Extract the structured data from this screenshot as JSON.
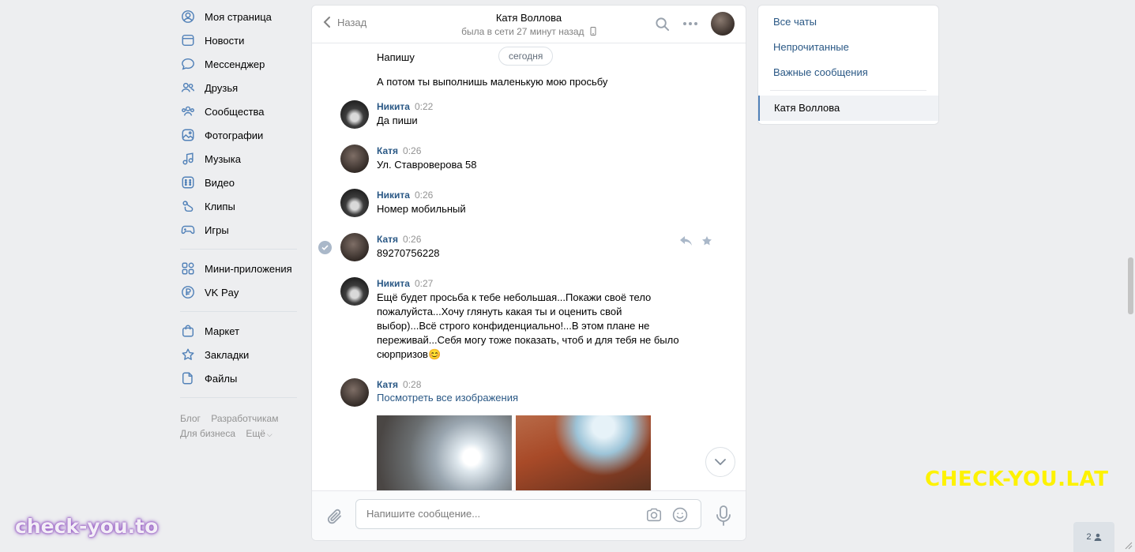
{
  "nav": {
    "items": [
      {
        "label": "Моя страница",
        "icon": "user-circle-icon"
      },
      {
        "label": "Новости",
        "icon": "news-icon"
      },
      {
        "label": "Мессенджер",
        "icon": "chat-bubble-icon"
      },
      {
        "label": "Друзья",
        "icon": "friends-icon"
      },
      {
        "label": "Сообщества",
        "icon": "communities-icon"
      },
      {
        "label": "Фотографии",
        "icon": "photos-icon"
      },
      {
        "label": "Музыка",
        "icon": "music-icon"
      },
      {
        "label": "Видео",
        "icon": "video-icon"
      },
      {
        "label": "Клипы",
        "icon": "clips-icon"
      },
      {
        "label": "Игры",
        "icon": "gamepad-icon"
      }
    ],
    "items2": [
      {
        "label": "Мини-приложения",
        "icon": "apps-icon"
      },
      {
        "label": "VK Pay",
        "icon": "vkpay-icon"
      }
    ],
    "items3": [
      {
        "label": "Маркет",
        "icon": "market-bag-icon"
      },
      {
        "label": "Закладки",
        "icon": "star-icon"
      },
      {
        "label": "Файлы",
        "icon": "file-icon"
      }
    ],
    "footer": {
      "blog": "Блог",
      "dev": "Разработчикам",
      "business": "Для бизнеса",
      "more": "Ещё"
    }
  },
  "chat": {
    "back_label": "Назад",
    "peer_name": "Катя Воллова",
    "peer_status": "была в сети 27 минут назад",
    "date_chip": "сегодня",
    "plain1": "Напишу",
    "plain2": "А потом ты выполнишь маленькую мою просьбу",
    "messages": [
      {
        "author": "Никита",
        "time": "0:22",
        "text": "Да пиши"
      },
      {
        "author": "Катя",
        "time": "0:26",
        "text": "Ул. Ставроверова 58"
      },
      {
        "author": "Никита",
        "time": "0:26",
        "text": "Номер мобильный"
      },
      {
        "author": "Катя",
        "time": "0:26",
        "text": "89270756228"
      },
      {
        "author": "Никита",
        "time": "0:27",
        "lines": [
          "Ещё будет просьба к тебе небольшая...Покажи своё тело",
          "пожалуйста...Хочу глянуть какая ты и оценить свой",
          "выбор)...Всё строго конфиденциально!...В этом плане не",
          "переживай...Себя могу тоже показать, чтоб и для тебя не было",
          "сюрпризов😊"
        ]
      },
      {
        "author": "Катя",
        "time": "0:28",
        "link": "Посмотреть все изображения"
      }
    ],
    "composer_placeholder": "Напишите сообщение..."
  },
  "folders": {
    "all": "Все чаты",
    "unread": "Непрочитанные",
    "important": "Важные сообщения",
    "active": "Катя Воллова"
  },
  "watermarks": {
    "yellow": "CHECK-YOU.LAT",
    "purple": "check-you.to"
  },
  "online_count": "2",
  "colors": {
    "link": "#2a5885",
    "background": "#edeef0",
    "accent": "#5181b8"
  }
}
